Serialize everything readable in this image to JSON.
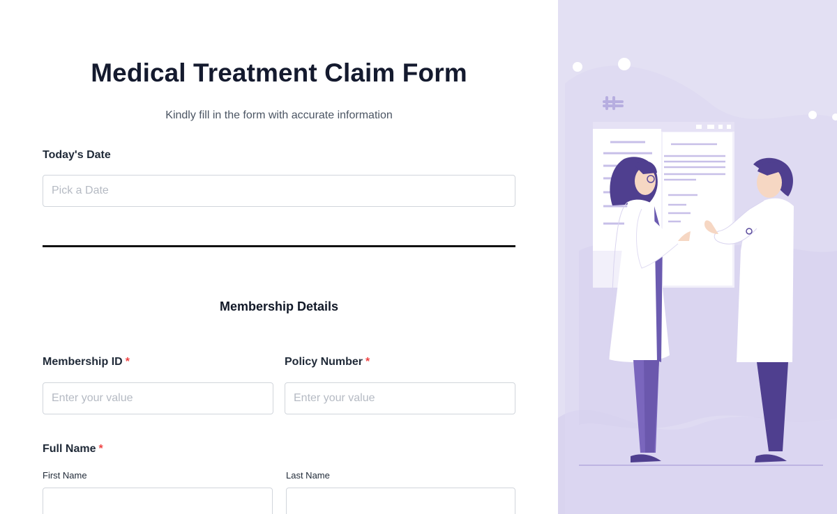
{
  "form": {
    "title": "Medical Treatment Claim Form",
    "subtitle": "Kindly fill in the form with accurate information",
    "todays_date": {
      "label": "Today's Date",
      "placeholder": "Pick a Date",
      "value": ""
    },
    "section_title": "Membership Details",
    "membership_id": {
      "label": "Membership ID",
      "required_mark": "*",
      "placeholder": "Enter your value",
      "value": ""
    },
    "policy_number": {
      "label": "Policy Number",
      "required_mark": "*",
      "placeholder": "Enter your value",
      "value": ""
    },
    "full_name": {
      "label": "Full Name",
      "required_mark": "*",
      "first_label": "First Name",
      "last_label": "Last Name",
      "first_value": "",
      "last_value": ""
    }
  },
  "colors": {
    "required": "#ef4444",
    "illustration_bg": "#e3e0f3",
    "accent_purple": "#5a4a9c"
  },
  "illustration": {
    "icon": "doctors-consultation-illustration"
  }
}
